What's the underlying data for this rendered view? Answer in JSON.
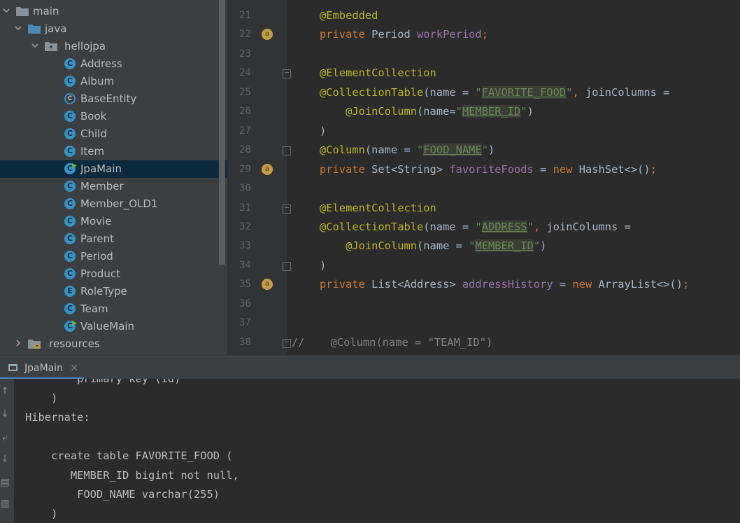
{
  "project_tree": [
    {
      "label": "main",
      "kind": "folder",
      "expanded": true,
      "depth": 0
    },
    {
      "label": "java",
      "kind": "source-folder",
      "expanded": true,
      "depth": 1
    },
    {
      "label": "hellojpa",
      "kind": "package",
      "expanded": true,
      "depth": 2
    },
    {
      "label": "Address",
      "kind": "class",
      "depth": 3
    },
    {
      "label": "Album",
      "kind": "class",
      "depth": 3
    },
    {
      "label": "BaseEntity",
      "kind": "abstract-class",
      "depth": 3
    },
    {
      "label": "Book",
      "kind": "class",
      "depth": 3
    },
    {
      "label": "Child",
      "kind": "class",
      "depth": 3
    },
    {
      "label": "Item",
      "kind": "class",
      "depth": 3
    },
    {
      "label": "JpaMain",
      "kind": "runnable-class",
      "depth": 3,
      "selected": true
    },
    {
      "label": "Member",
      "kind": "class",
      "depth": 3
    },
    {
      "label": "Member_OLD1",
      "kind": "class",
      "depth": 3
    },
    {
      "label": "Movie",
      "kind": "class",
      "depth": 3
    },
    {
      "label": "Parent",
      "kind": "class",
      "depth": 3
    },
    {
      "label": "Period",
      "kind": "class",
      "depth": 3
    },
    {
      "label": "Product",
      "kind": "class",
      "depth": 3
    },
    {
      "label": "RoleType",
      "kind": "enum",
      "depth": 3
    },
    {
      "label": "Team",
      "kind": "class",
      "depth": 3
    },
    {
      "label": "ValueMain",
      "kind": "runnable-class",
      "depth": 3
    },
    {
      "label": "resources",
      "kind": "resources-folder",
      "expanded": false,
      "depth": 1
    }
  ],
  "editor": {
    "line_numbers": [
      "21",
      "22",
      "23",
      "24",
      "25",
      "26",
      "27",
      "28",
      "29",
      "30",
      "31",
      "32",
      "33",
      "34",
      "35",
      "36",
      "37",
      "38"
    ],
    "code": [
      [
        {
          "t": "@Embedded",
          "c": "ann"
        }
      ],
      [
        {
          "t": "private ",
          "c": "kw"
        },
        {
          "t": "Period ",
          "c": ""
        },
        {
          "t": "workPeriod",
          "c": "field"
        },
        {
          "t": ";",
          "c": "kw"
        }
      ],
      [],
      [
        {
          "t": "@ElementCollection",
          "c": "ann"
        }
      ],
      [
        {
          "t": "@CollectionTable",
          "c": "ann"
        },
        {
          "t": "(name = ",
          "c": ""
        },
        {
          "t": "\"",
          "c": "str"
        },
        {
          "t": "FAVORITE_FOOD",
          "c": "hl"
        },
        {
          "t": "\"",
          "c": "str"
        },
        {
          "t": ", ",
          "c": "kw"
        },
        {
          "t": "joinColumns =",
          "c": ""
        }
      ],
      [
        {
          "t": "    ",
          "c": ""
        },
        {
          "t": "@JoinColumn",
          "c": "ann"
        },
        {
          "t": "(name=",
          "c": ""
        },
        {
          "t": "\"",
          "c": "str"
        },
        {
          "t": "MEMBER_ID",
          "c": "hl"
        },
        {
          "t": "\"",
          "c": "str"
        },
        {
          "t": ")",
          "c": ""
        }
      ],
      [
        {
          "t": ")",
          "c": ""
        }
      ],
      [
        {
          "t": "@Column",
          "c": "ann"
        },
        {
          "t": "(name = ",
          "c": ""
        },
        {
          "t": "\"",
          "c": "str"
        },
        {
          "t": "FOOD_NAME",
          "c": "hl"
        },
        {
          "t": "\"",
          "c": "str"
        },
        {
          "t": ")",
          "c": ""
        }
      ],
      [
        {
          "t": "private ",
          "c": "kw"
        },
        {
          "t": "Set<String> ",
          "c": ""
        },
        {
          "t": "favoriteFoods",
          "c": "field"
        },
        {
          "t": " = ",
          "c": ""
        },
        {
          "t": "new ",
          "c": "kw"
        },
        {
          "t": "HashSet<>()",
          "c": ""
        },
        {
          "t": ";",
          "c": "kw"
        }
      ],
      [],
      [
        {
          "t": "@ElementCollection",
          "c": "ann"
        }
      ],
      [
        {
          "t": "@CollectionTable",
          "c": "ann"
        },
        {
          "t": "(name = ",
          "c": ""
        },
        {
          "t": "\"",
          "c": "str"
        },
        {
          "t": "ADDRESS",
          "c": "hl"
        },
        {
          "t": "\"",
          "c": "str"
        },
        {
          "t": ", ",
          "c": "kw"
        },
        {
          "t": "joinColumns =",
          "c": ""
        }
      ],
      [
        {
          "t": "    ",
          "c": ""
        },
        {
          "t": "@JoinColumn",
          "c": "ann"
        },
        {
          "t": "(name = ",
          "c": ""
        },
        {
          "t": "\"",
          "c": "str"
        },
        {
          "t": "MEMBER_ID",
          "c": "hl"
        },
        {
          "t": "\"",
          "c": "str"
        },
        {
          "t": ")",
          "c": ""
        }
      ],
      [
        {
          "t": ")",
          "c": ""
        }
      ],
      [
        {
          "t": "private ",
          "c": "kw"
        },
        {
          "t": "List<Address> ",
          "c": ""
        },
        {
          "t": "addressHistory",
          "c": "field"
        },
        {
          "t": " = ",
          "c": ""
        },
        {
          "t": "new ",
          "c": "kw"
        },
        {
          "t": "ArrayList<>()",
          "c": ""
        },
        {
          "t": ";",
          "c": "kw"
        }
      ],
      [],
      [],
      [
        {
          "t": "//    @Column(name = \"TEAM_ID\")",
          "c": "cmt"
        }
      ]
    ],
    "annotation_badge": "a",
    "badge_lines": [
      "22",
      "29",
      "35"
    ]
  },
  "run_panel": {
    "tab_label": "JpaMain",
    "tab_close": "×",
    "console_lines": [
      "        primary key (id)",
      "    )",
      "Hibernate: ",
      "",
      "    create table FAVORITE_FOOD (",
      "       MEMBER_ID bigint not null,",
      "        FOOD_NAME varchar(255)",
      "    )"
    ]
  },
  "colors": {
    "annotation": "#bbb529",
    "keyword": "#cc7832",
    "field": "#9876aa",
    "string": "#6a8759",
    "selection": "#0d293e"
  }
}
